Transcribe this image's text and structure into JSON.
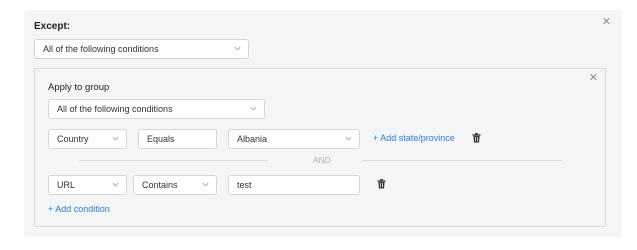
{
  "except": {
    "title": "Except:",
    "match_select": "All of the following conditions"
  },
  "group": {
    "title": "Apply to group",
    "match_select": "All of the following conditions",
    "conditions": [
      {
        "field": "Country",
        "operator": "Equals",
        "value": "Albania",
        "extra_link": "+ Add state/province"
      },
      {
        "field": "URL",
        "operator": "Contains",
        "value": "test"
      }
    ],
    "separator": "AND",
    "add_condition": "+ Add condition"
  },
  "icons": {
    "close": "close-icon",
    "chevron": "chevron-down-icon",
    "trash": "trash-icon"
  },
  "colors": {
    "link": "#2f7bd9",
    "panel_bg": "#f4f5f6",
    "border": "#d3d6da"
  }
}
